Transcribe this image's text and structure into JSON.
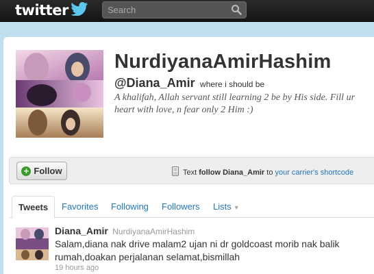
{
  "header": {
    "logo_text": "twitter",
    "search_placeholder": "Search",
    "logo_icon": "bird-icon",
    "search_icon": "search-icon"
  },
  "profile": {
    "display_name": "NurdiyanaAmirHashim",
    "handle": "@Diana_Amir",
    "location": "where i should be",
    "bio": "A khalifah, Allah servant still learning 2 be by His side. Fill ur heart with love, n fear only 2 Him :)"
  },
  "follow_bar": {
    "follow_label": "Follow",
    "sms_prefix": "Text",
    "sms_command": "follow Diana_Amir",
    "sms_to": "to",
    "sms_link": "your carrier's shortcode",
    "phone_icon": "phone-icon",
    "plus_icon": "plus-icon"
  },
  "tabs": [
    {
      "label": "Tweets"
    },
    {
      "label": "Favorites"
    },
    {
      "label": "Following"
    },
    {
      "label": "Followers"
    },
    {
      "label": "Lists"
    }
  ],
  "tweets": [
    {
      "username": "Diana_Amir",
      "name": "NurdiyanaAmirHashim",
      "text": "Salam,diana nak drive malam2 ujan ni dr goldcoast morib nak balik rumah,doakan perjalanan selamat,bismillah",
      "time": "19 hours ago"
    }
  ],
  "colors": {
    "page_bg": "#c0deed",
    "link": "#2276bb",
    "topbar": "#1c1c1c"
  }
}
